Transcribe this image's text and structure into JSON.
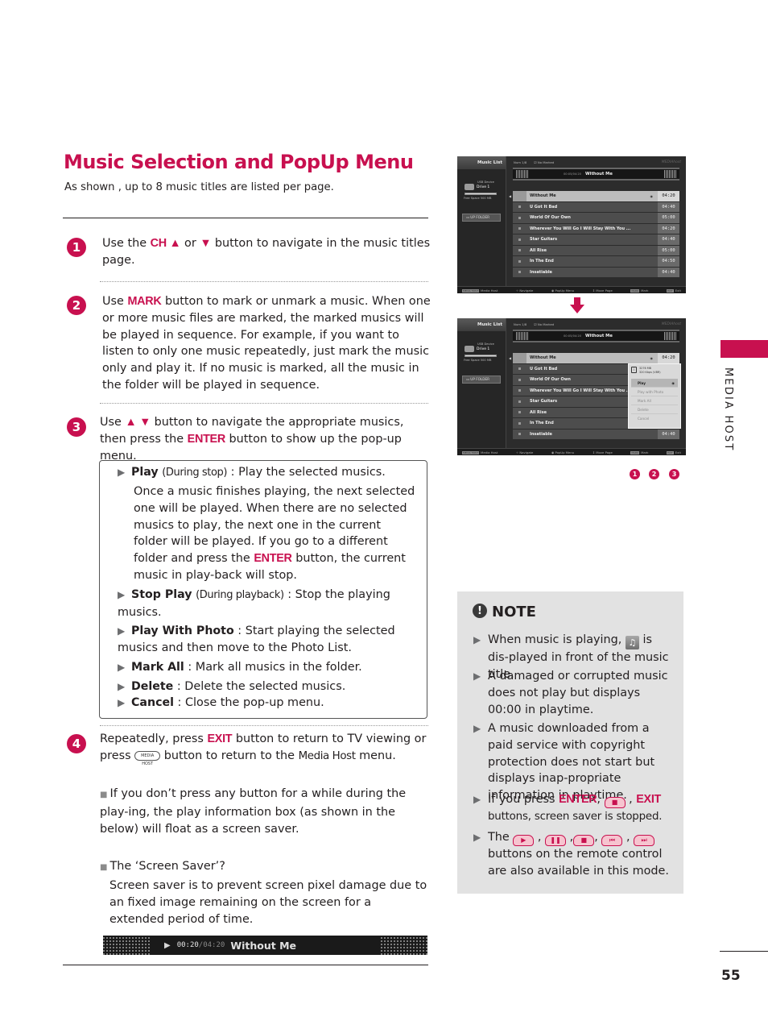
{
  "page": {
    "title": "Music Selection and PopUp Menu",
    "subtitle": "As shown , up to 8 music titles are listed per page.",
    "page_number": "55",
    "section_label": "MEDIA HOST"
  },
  "steps": [
    {
      "num": "1",
      "parts": [
        "Use the ",
        "CH ▲",
        " or ",
        "▼",
        " button to navigate in the music titles page."
      ]
    },
    {
      "num": "2",
      "parts": [
        "Use ",
        "MARK",
        " button to mark or unmark a music. When one or more music files are marked, the marked musics will be played in sequence. For example, if you want to listen to only one music repeatedly, just mark the music only and play it. If no music is marked, all the music in the folder  will be played in sequence."
      ]
    },
    {
      "num": "3",
      "parts": [
        "Use ",
        "▲ ▼",
        " button to navigate the appropriate musics, then press the ",
        "ENTER",
        " button to show up the pop-up  menu."
      ]
    },
    {
      "num": "4",
      "parts": [
        "Repeatedly, press ",
        "EXIT",
        " button to return to TV viewing or press ",
        "MEDIA HOST",
        " button to return to the ",
        "Media Host",
        " menu."
      ]
    }
  ],
  "popup_items": [
    {
      "name": "Play",
      "paren": "(During stop)",
      "desc": " : Play the selected musics.",
      "detail_parts": [
        "Once a music finishes playing, the next selected one will be played. When there are no selected musics to play, the next one in the current folder will be played. If you go to a different folder and press the ",
        "ENTER",
        " button, the current music in play-back will stop."
      ]
    },
    {
      "name": "Stop Play",
      "paren": "(During playback)",
      "desc": " : Stop the playing musics."
    },
    {
      "name": "Play With Photo",
      "paren": "",
      "desc": " : Start playing the selected musics and then move to the Photo List."
    },
    {
      "name": "Mark All",
      "paren": "",
      "desc": " : Mark all musics in the folder."
    },
    {
      "name": "Delete",
      "paren": "",
      "desc": " : Delete the selected musics."
    },
    {
      "name": "Cancel",
      "paren": "",
      "desc": " : Close the pop-up menu."
    }
  ],
  "screensaver": {
    "bullet1": "If you don’t press any button for a while during the play-ing, the play information box (as shown in the below) will float as a screen saver.",
    "bullet2_title": "The ‘Screen Saver’?",
    "bullet2_body": "Screen saver is to prevent screen pixel damage due to an fixed image remaining on the screen for a extended period of time.",
    "bar_elapsed": "00:20",
    "bar_total": "/04:20",
    "bar_title": "Without Me"
  },
  "tv": {
    "panel_title": "Music List",
    "device": "USB Device",
    "drive": "Drive 1",
    "free_space": "Free Space 500 MB",
    "up_folder": "UP FOLDER",
    "num_label": "Num 1/8",
    "marked_label": "No Marked",
    "logo": "MEDIAhost",
    "np_time": "00:05/04:20",
    "np_title": "Without Me",
    "tracks": [
      {
        "title": "Without Me",
        "time": "04:20"
      },
      {
        "title": "U Got It Bad",
        "time": "04:40"
      },
      {
        "title": "World Of Our Own",
        "time": "05:00"
      },
      {
        "title": "Wherever You Will Go I Will Stay With You ...",
        "time": "04:20"
      },
      {
        "title": "Star Guitars",
        "time": "04:40"
      },
      {
        "title": "All Rise",
        "time": "05:00"
      },
      {
        "title": "In The End",
        "time": "04:50"
      },
      {
        "title": "Insatiable",
        "time": "04:40"
      }
    ],
    "footer": {
      "media_host": "Media Host",
      "navigate": "Navigate",
      "popup_menu": "PopUp Menu",
      "move_page": "Move Page",
      "mark": "Mark",
      "exit": "Exit"
    },
    "popup": {
      "size": "3276 MB",
      "bitrate": "320 Kbps (VBR)",
      "options": [
        "Play",
        "Play with Photo",
        "Mark All",
        "Delete",
        "Cancel"
      ]
    },
    "step_markers": [
      "1",
      "2",
      "3"
    ]
  },
  "note": {
    "title": "NOTE",
    "items": [
      {
        "parts": [
          "When music is playing, ",
          "MUSIC_ICON",
          " is dis-played in front of the music title."
        ]
      },
      {
        "parts": [
          "A damaged or corrupted music does not play but displays 00:00 in playtime."
        ]
      },
      {
        "parts": [
          "A music downloaded from a paid service with copyright protection does not start but displays inap-propriate information in playtime."
        ]
      },
      {
        "parts": [
          "If you press ",
          "ENTER",
          ", ",
          "STOP",
          " , ",
          "EXIT",
          " buttons, screen saver is  stopped."
        ]
      },
      {
        "parts": [
          "The ",
          "PLAY",
          " , ",
          "PAUSE",
          " ,",
          "STOP",
          ", ",
          "REW",
          " , ",
          "FF",
          " buttons on the remote control are also available in this mode."
        ]
      }
    ]
  }
}
